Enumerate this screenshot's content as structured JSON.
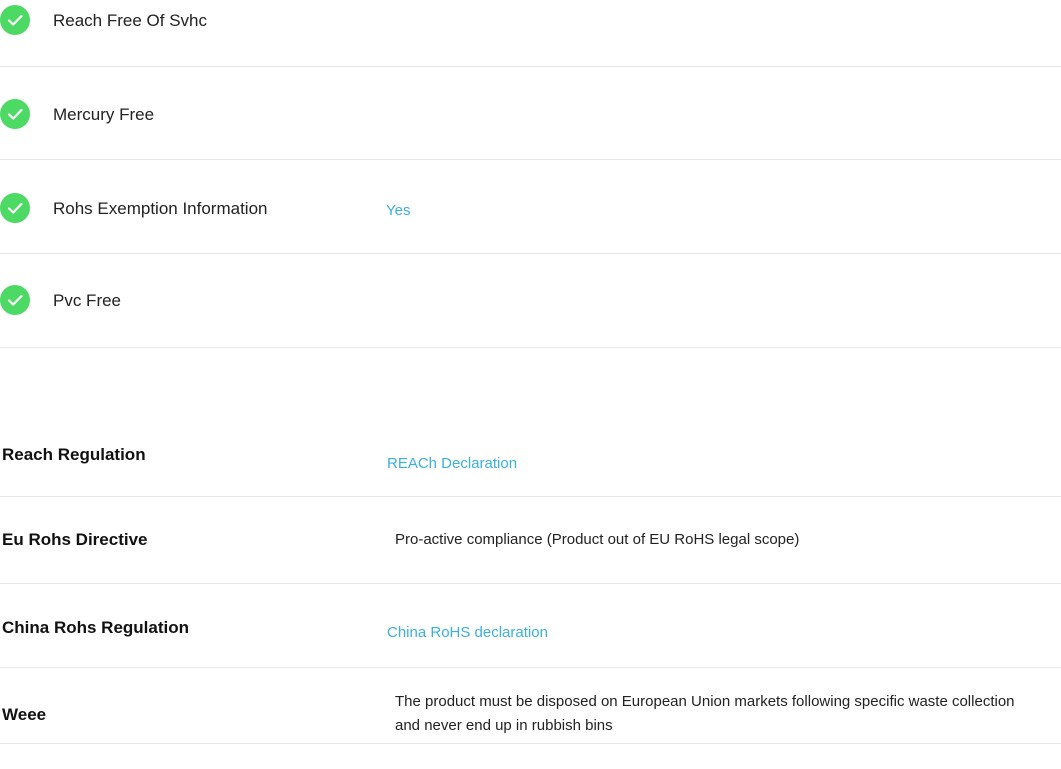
{
  "checks": [
    {
      "label": "Reach Free Of Svhc",
      "value": "",
      "icon": "check-circle-icon"
    },
    {
      "label": "Mercury Free",
      "value": "",
      "icon": "check-circle-icon"
    },
    {
      "label": "Rohs Exemption Information",
      "value": "Yes",
      "icon": "check-circle-icon"
    },
    {
      "label": "Pvc Free",
      "value": "",
      "icon": "check-circle-icon"
    }
  ],
  "regulations": [
    {
      "label": "Reach Regulation",
      "value": "REACh Declaration",
      "is_link": true
    },
    {
      "label": "Eu Rohs Directive",
      "value": "Pro-active compliance (Product out of EU RoHS legal scope)",
      "is_link": false
    },
    {
      "label": "China Rohs Regulation",
      "value": "China RoHS declaration",
      "is_link": true
    },
    {
      "label": "Weee",
      "value": "The product must be disposed on European Union markets following specific waste collection and never end up in rubbish bins",
      "is_link": false
    }
  ],
  "colors": {
    "check_green": "#4cd964",
    "link_blue": "#3ab0e2",
    "divider": "#e6e6e6"
  }
}
